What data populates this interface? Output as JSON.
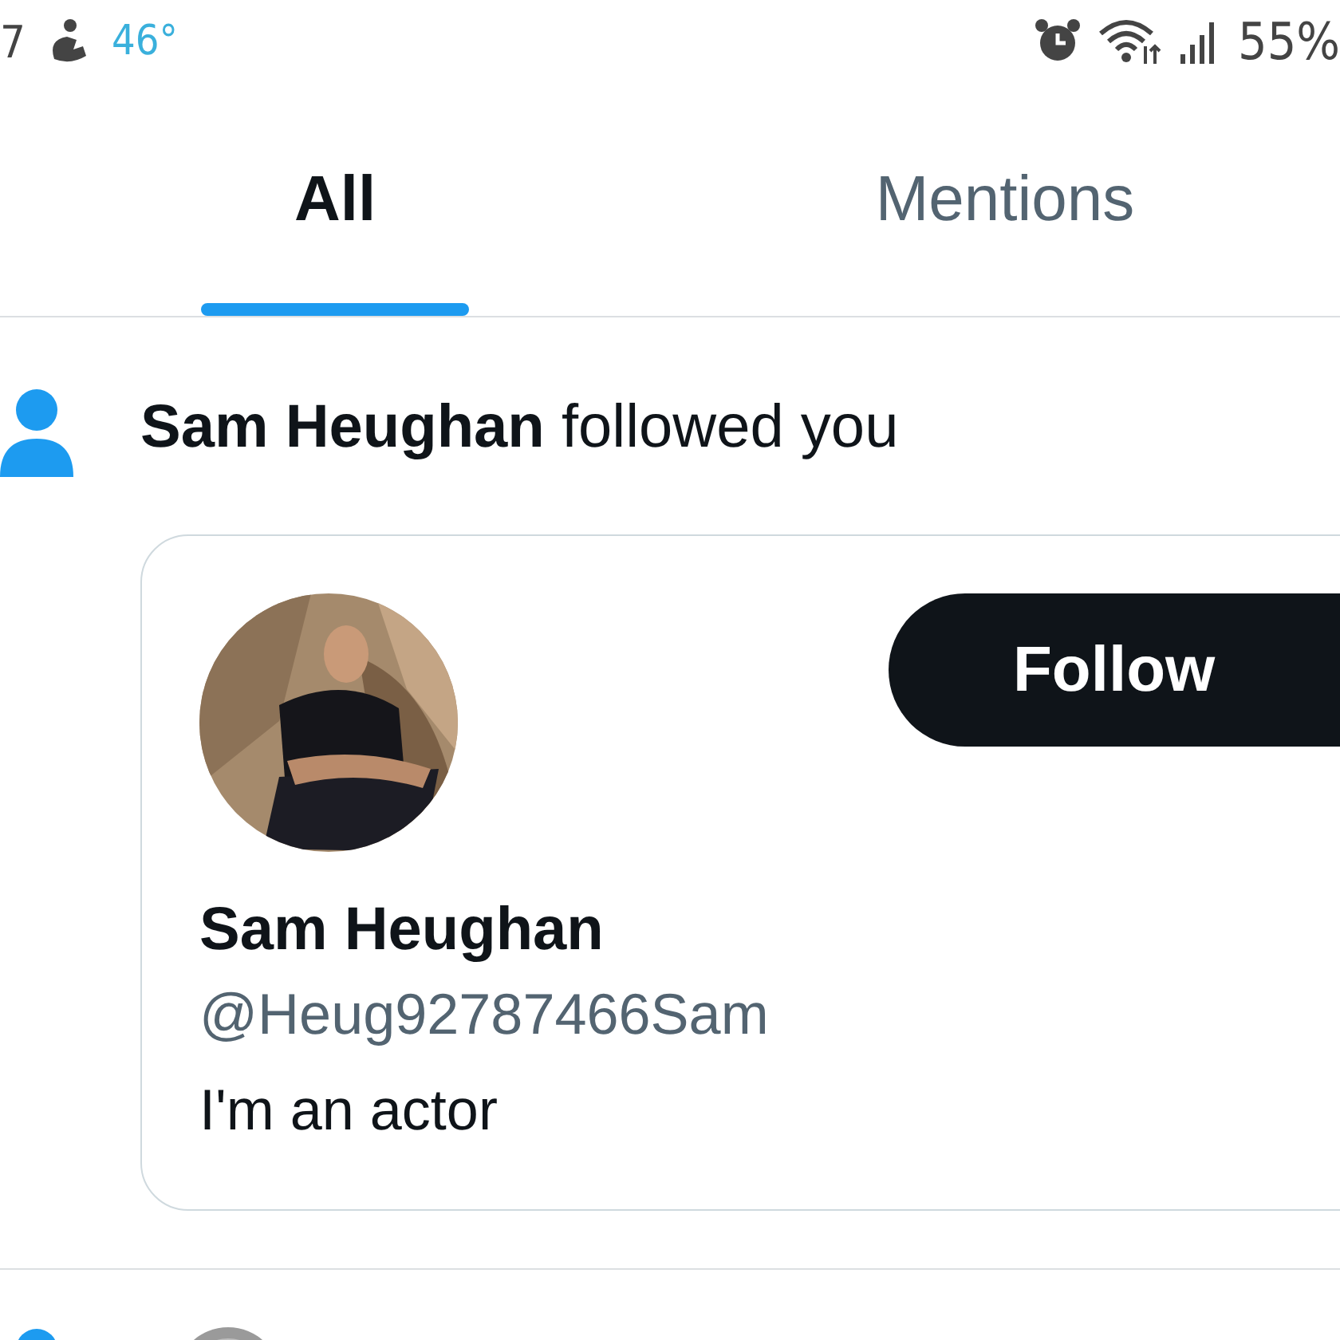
{
  "status_bar": {
    "time": "7",
    "temperature": "46°",
    "battery": "55%"
  },
  "tabs": [
    {
      "label": "All",
      "selected": true
    },
    {
      "label": "Mentions",
      "selected": false
    }
  ],
  "notifications": [
    {
      "kind": "follow",
      "name": "Sam Heughan",
      "action": "followed you",
      "card": {
        "name": "Sam Heughan",
        "handle": "@Heug92787466Sam",
        "bio": "I'm an actor",
        "button": "Follow"
      }
    },
    {
      "kind": "partial"
    }
  ]
}
